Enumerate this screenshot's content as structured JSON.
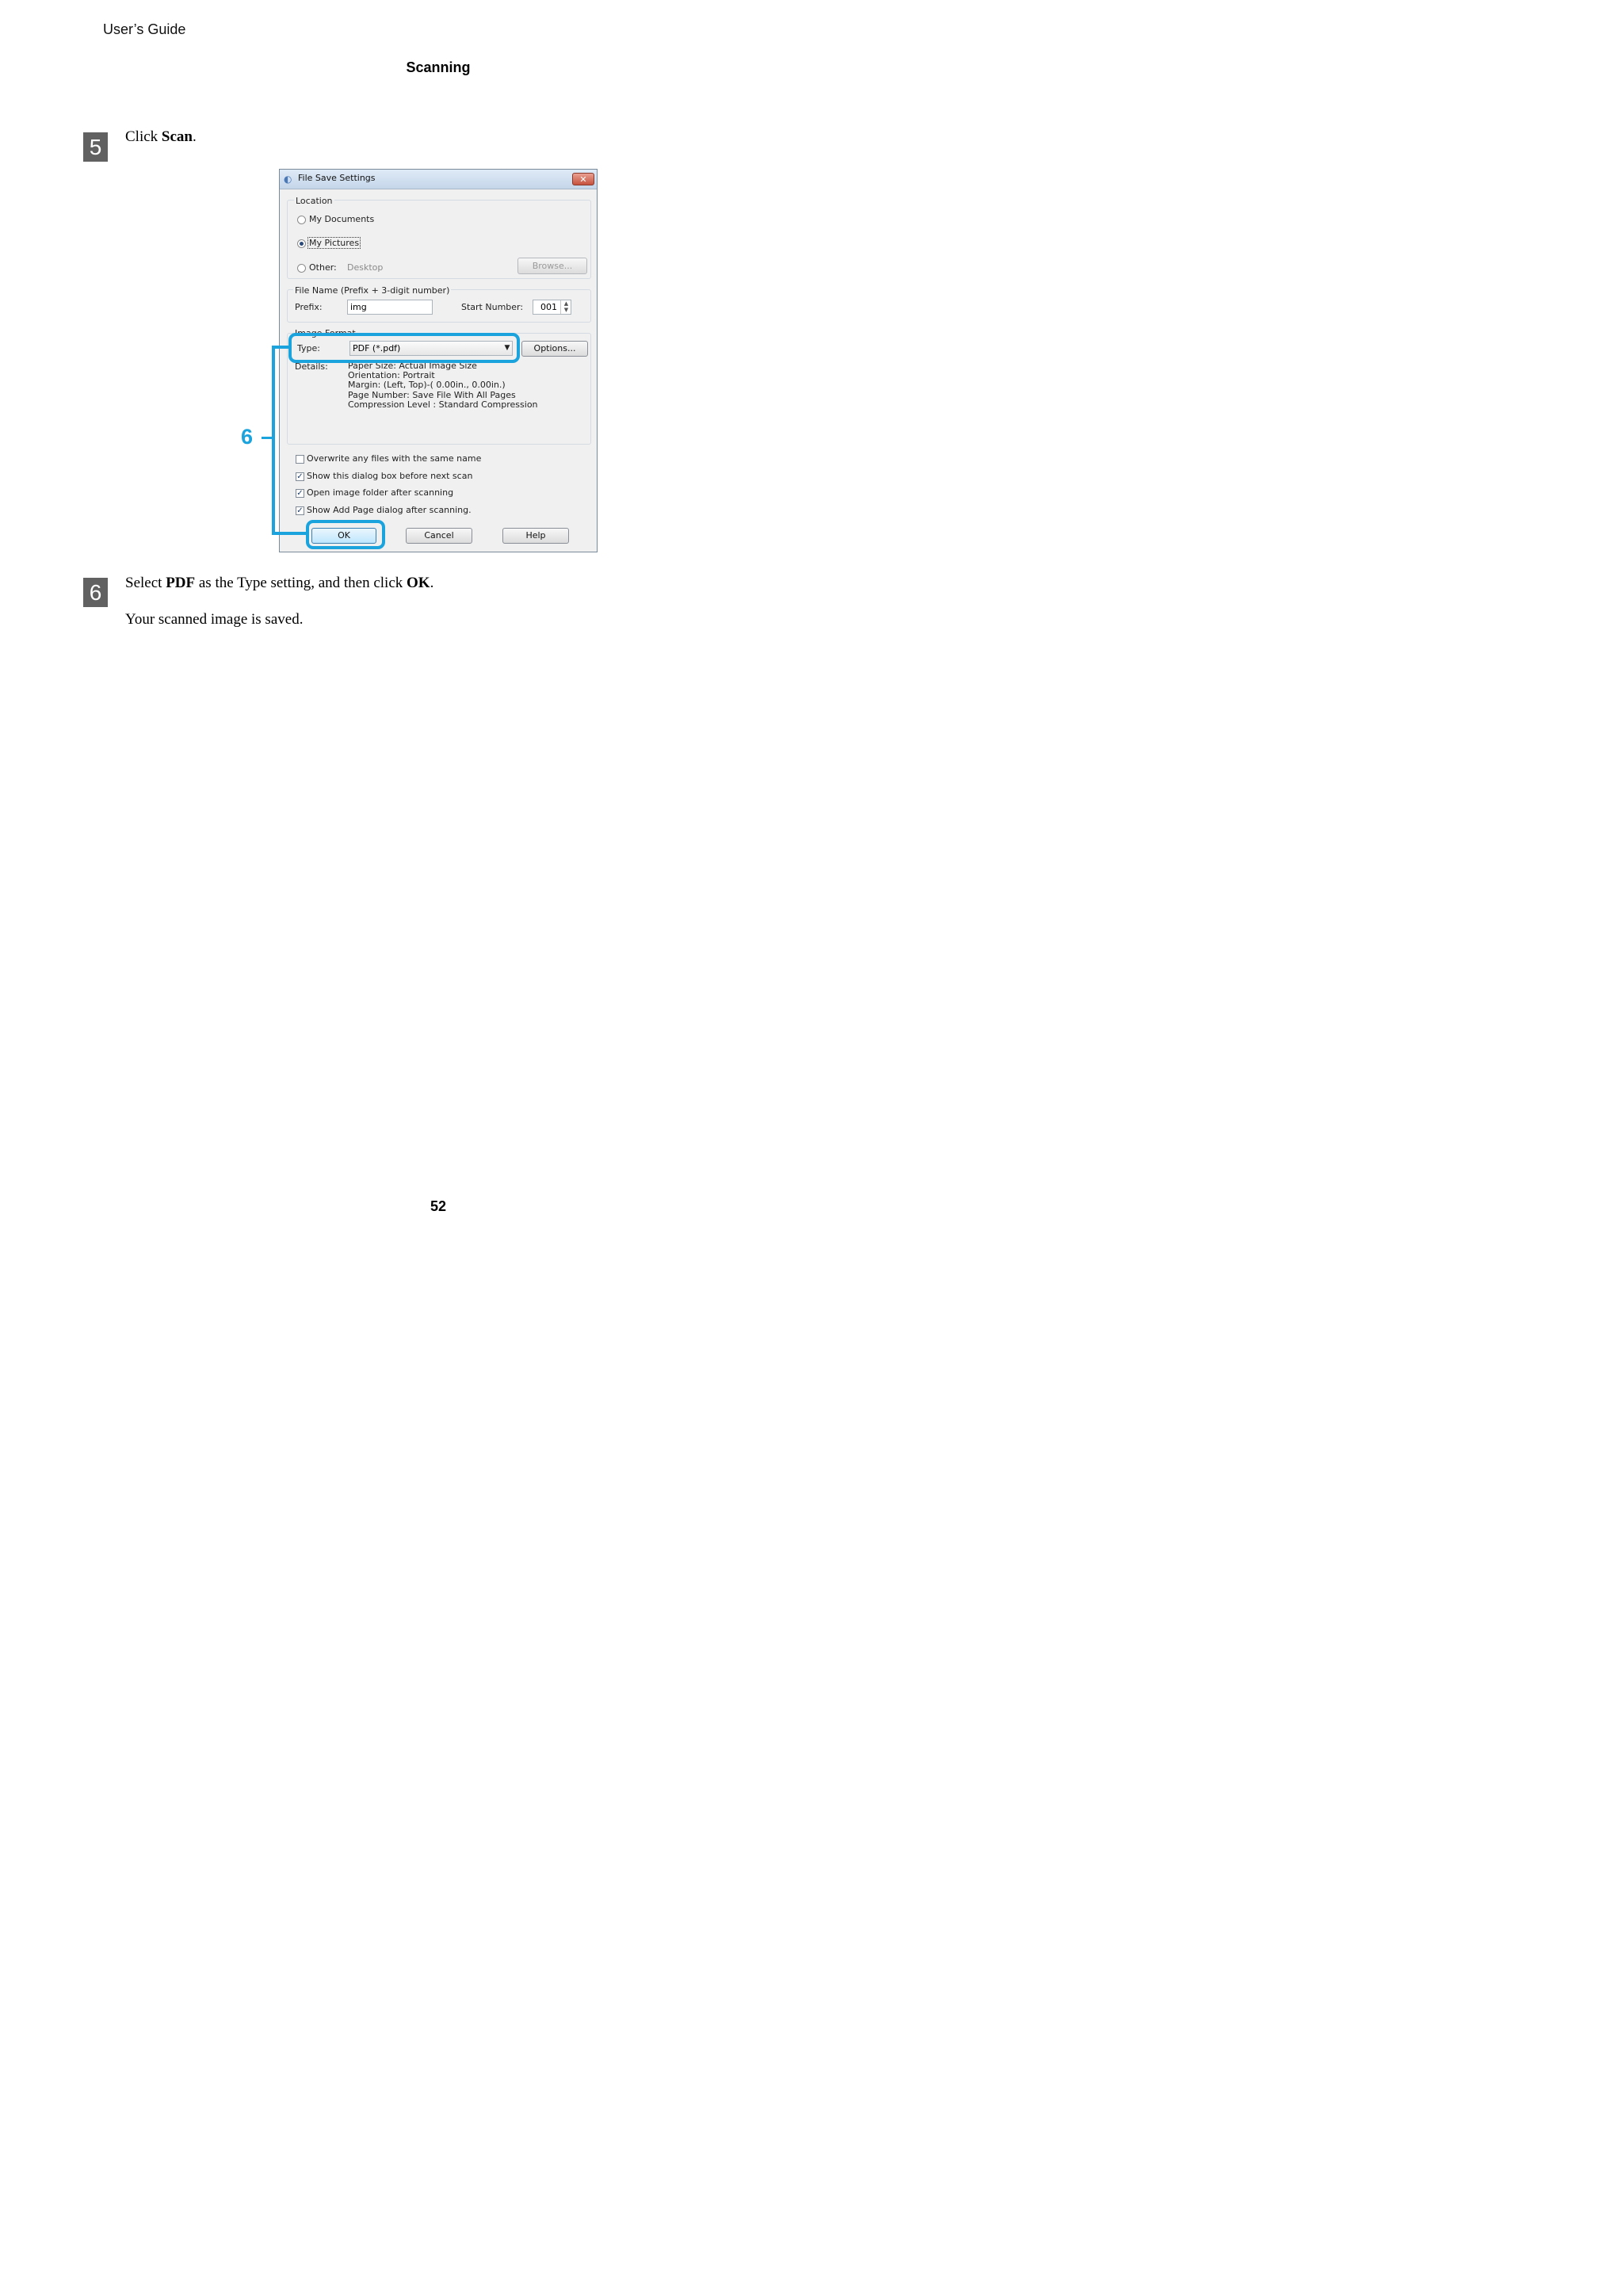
{
  "header": {
    "running_head": "User’s Guide",
    "section": "Scanning"
  },
  "steps": [
    {
      "number": "5",
      "prefix": "Click ",
      "bold": "Scan",
      "suffix": "."
    },
    {
      "number": "6",
      "prefix": "Select ",
      "bold1": "PDF",
      "middle": " as the Type setting, and then click ",
      "bold2": "OK",
      "suffix": ".",
      "followup": "Your scanned image is saved."
    }
  ],
  "callout": {
    "label": "6",
    "color": "#1aa3dd"
  },
  "dialog": {
    "title": "File Save Settings",
    "close_glyph": "✕",
    "location": {
      "label": "Location",
      "options": [
        "My Documents",
        "My Pictures",
        "Other:"
      ],
      "selected": "My Pictures",
      "other_value": "Desktop",
      "browse_label": "Browse..."
    },
    "file_name": {
      "label": "File Name (Prefix + 3-digit number)",
      "prefix_label": "Prefix:",
      "prefix_value": "img",
      "start_label": "Start Number:",
      "start_value": "001"
    },
    "image_format": {
      "label": "Image Format",
      "type_label": "Type:",
      "type_value": "PDF (*.pdf)",
      "options_label": "Options...",
      "details_label": "Details:",
      "details": [
        "Paper Size: Actual Image Size",
        "Orientation: Portrait",
        "Margin: (Left, Top)-( 0.00in., 0.00in.)",
        "Page Number: Save File With All Pages",
        "Compression Level : Standard Compression"
      ]
    },
    "checkboxes": [
      {
        "label": "Overwrite any files with the same name",
        "checked": false
      },
      {
        "label": "Show this dialog box before next scan",
        "checked": true
      },
      {
        "label": "Open image folder after scanning",
        "checked": true
      },
      {
        "label": "Show Add Page dialog after scanning.",
        "checked": true
      }
    ],
    "buttons": {
      "ok": "OK",
      "cancel": "Cancel",
      "help": "Help"
    }
  },
  "footer": {
    "page_number": "52"
  }
}
